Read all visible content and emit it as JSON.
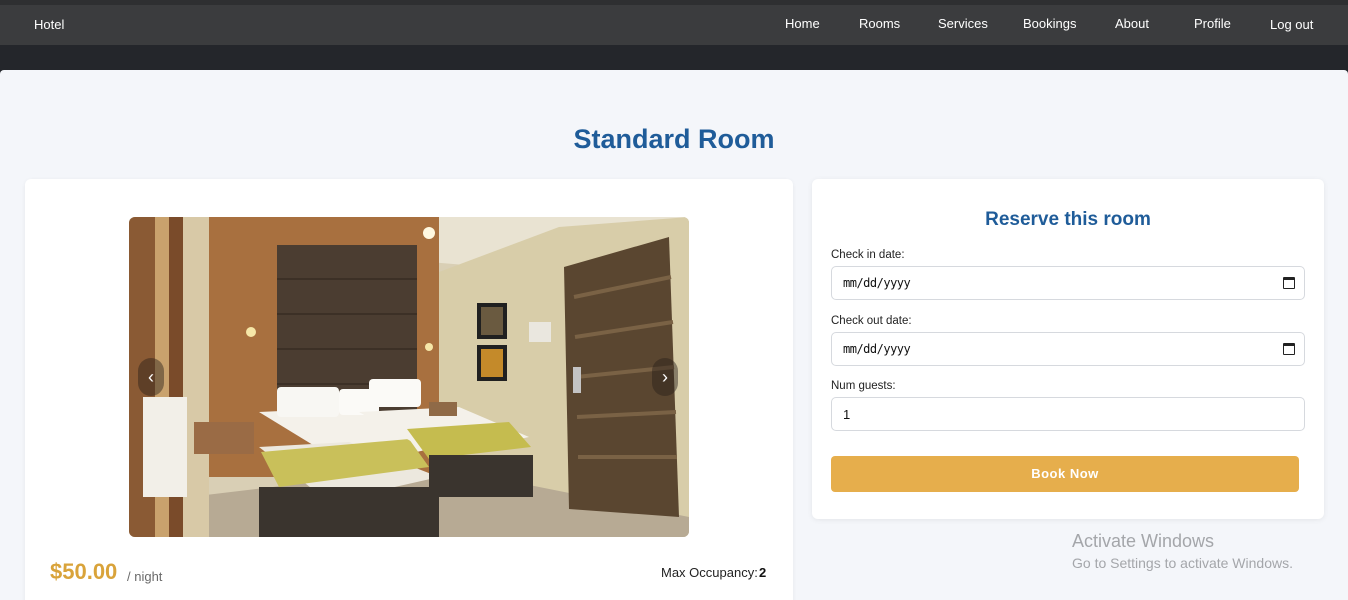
{
  "nav": {
    "brand": "Hotel",
    "links": [
      "Home",
      "Rooms",
      "Services",
      "Bookings",
      "About",
      "Profile",
      "Log out"
    ]
  },
  "room": {
    "title": "Standard Room",
    "price": "$50.00",
    "per_night": "/ night",
    "occupancy_label": "Max Occupancy:",
    "occupancy_value": "2",
    "carousel": {
      "prev_icon": "chevron-left",
      "next_icon": "chevron-right",
      "prev_glyph": "‹",
      "next_glyph": "›"
    }
  },
  "reservation": {
    "title": "Reserve this room",
    "check_in_label": "Check in date:",
    "check_in_value": "mm/dd/yyyy",
    "check_out_label": "Check out date:",
    "check_out_value": "mm/dd/yyyy",
    "guests_label": "Num guests:",
    "guests_value": "1",
    "book_button": "Book Now"
  },
  "watermark": {
    "line1": "Activate Windows",
    "line2": "Go to Settings to activate Windows."
  },
  "colors": {
    "title_blue": "#1f5c99",
    "accent_gold": "#e6ae4c",
    "navbar": "#3b3c3e"
  }
}
